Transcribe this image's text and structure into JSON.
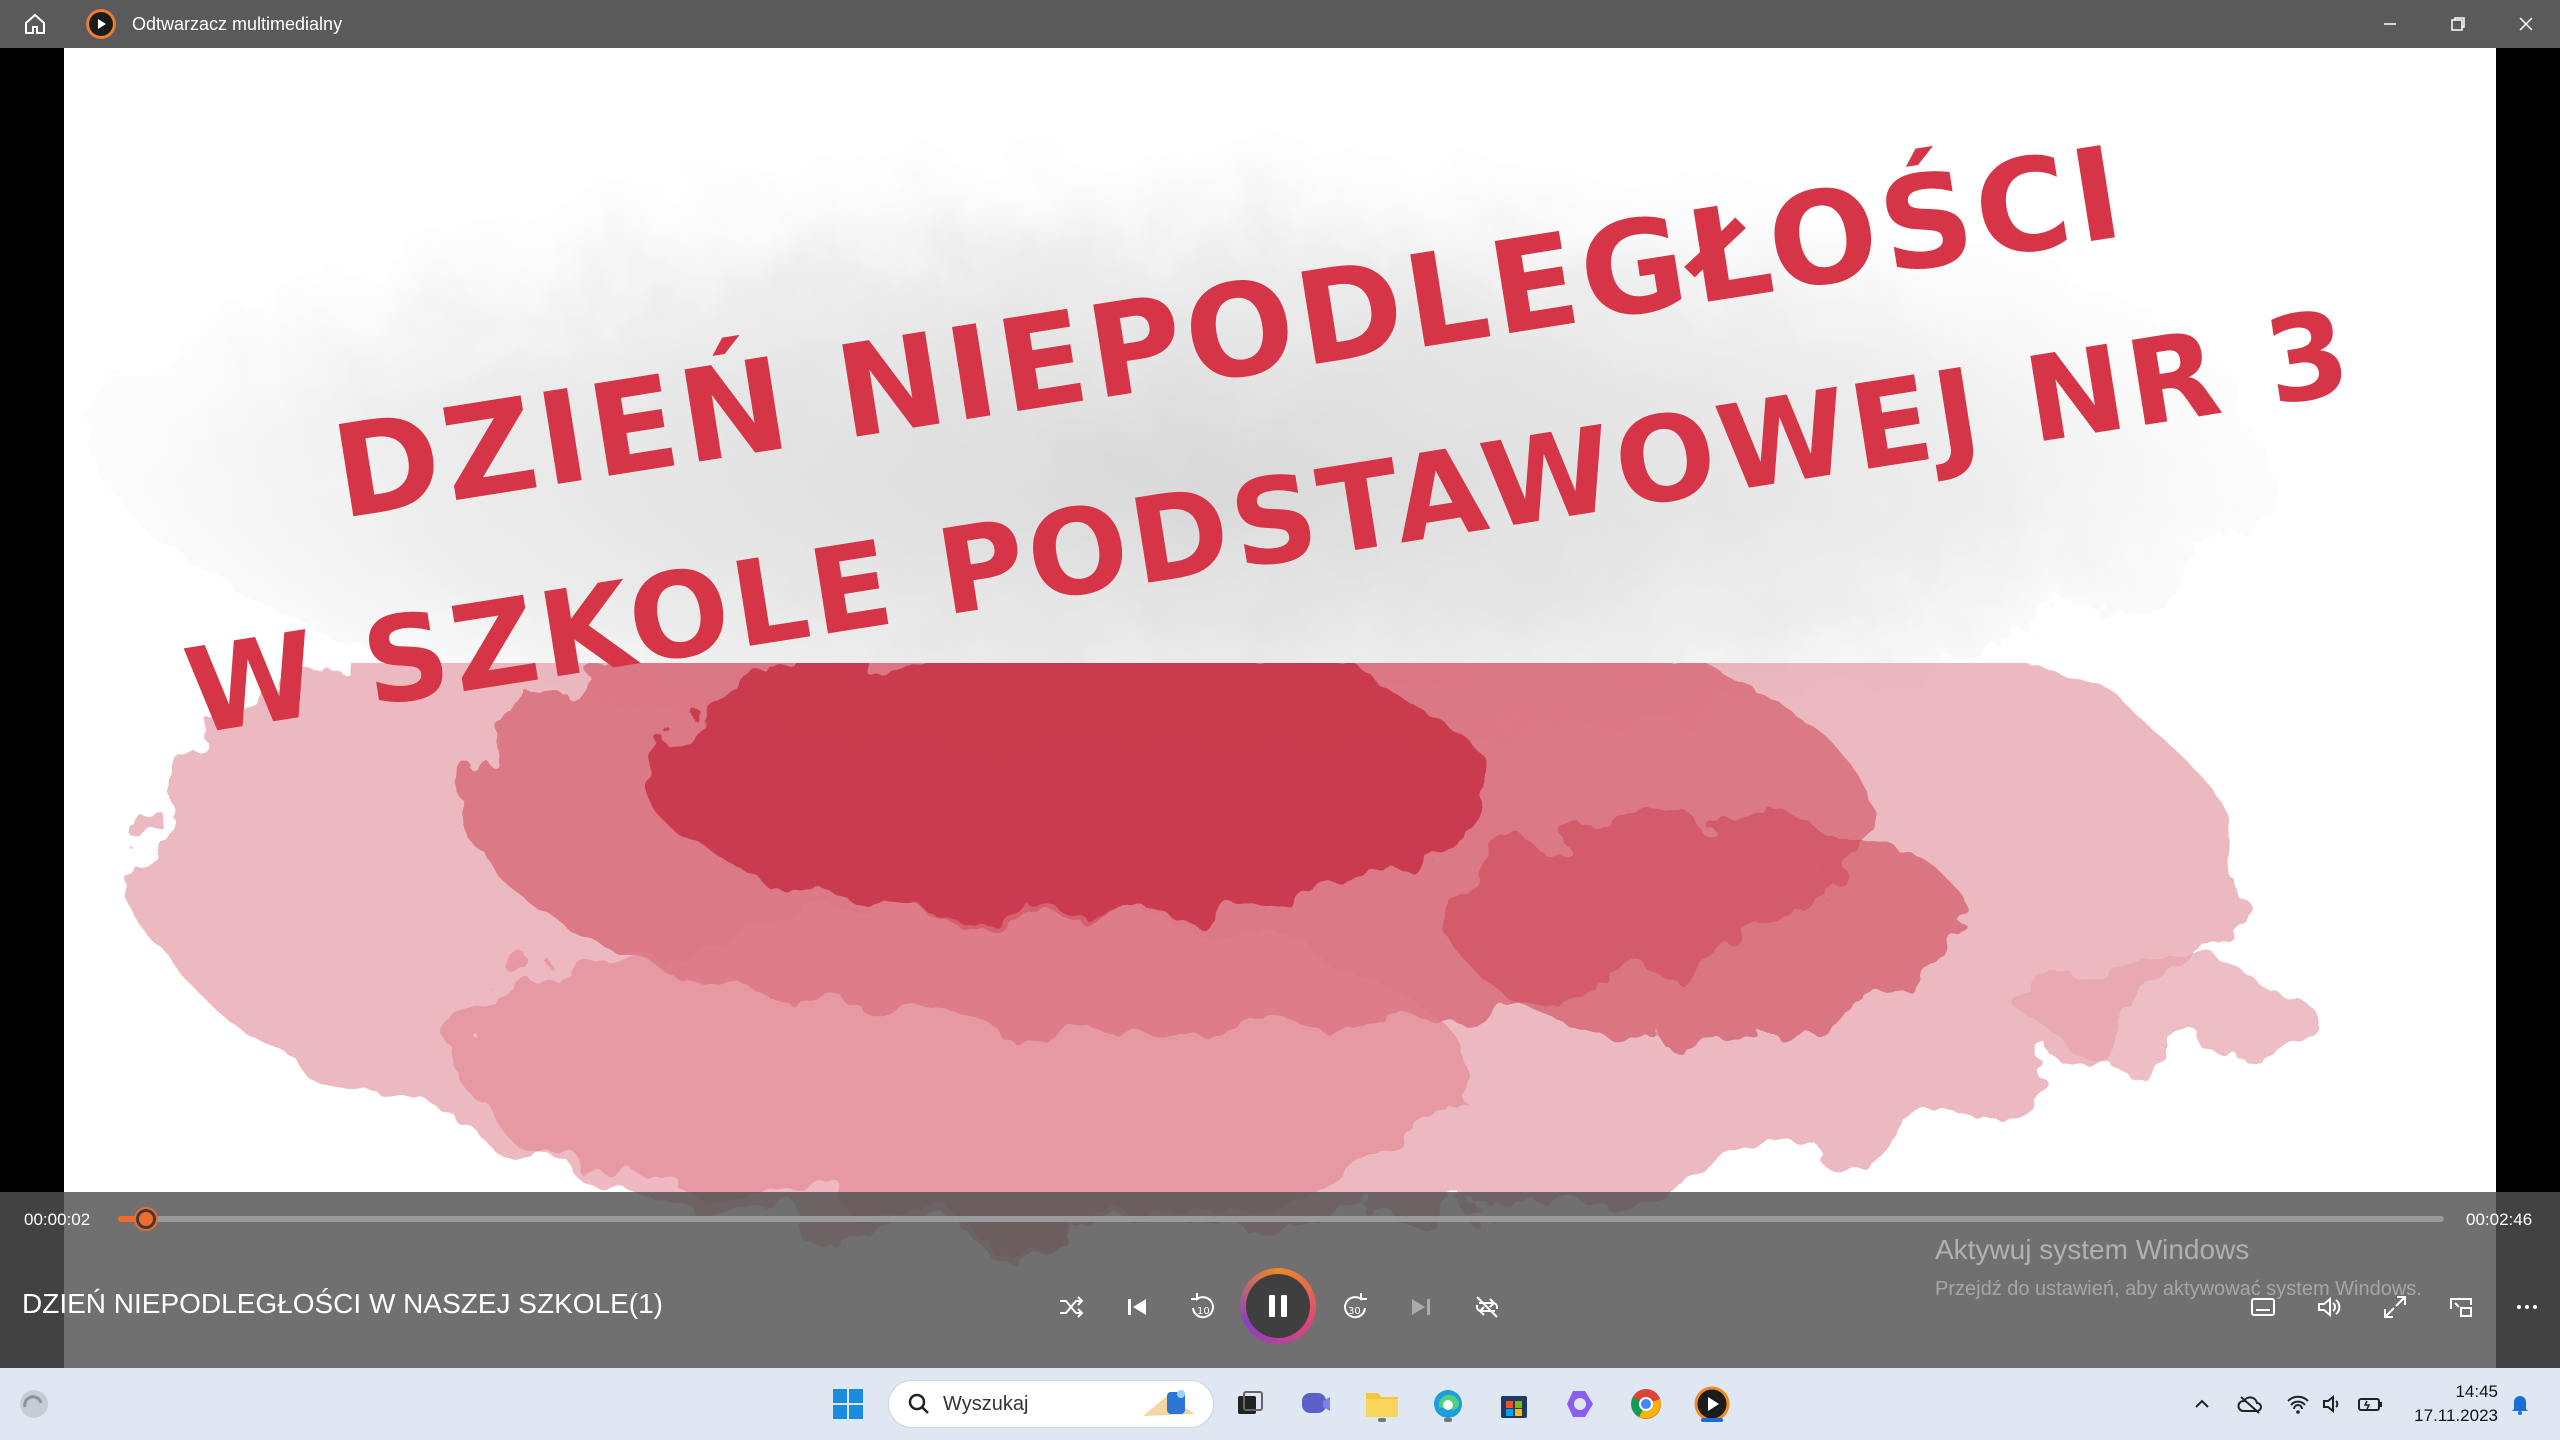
{
  "window": {
    "title": "Odtwarzacz multimedialny",
    "controls": [
      "minimize",
      "restore",
      "close"
    ]
  },
  "video": {
    "title_line1": "DZIEŃ NIEPODLEGŁOŚCI",
    "title_line2": "W SZKOLE PODSTAWOWEJ NR 3",
    "text_color": "#d63447",
    "flag_red": "#c82a3c"
  },
  "player": {
    "current_time": "00:00:02",
    "total_time": "00:02:46",
    "progress": 0.012,
    "media_title": "DZIEŃ NIEPODLEGŁOŚCI W NASZEJ SZKOLE(1)",
    "accent": "#f26b2a",
    "state": "playing",
    "buttons": [
      "shuffle-icon",
      "previous-icon",
      "rewind-10-icon",
      "pause-icon",
      "forward-30-icon",
      "next-icon",
      "repeat-icon",
      "captions-icon",
      "volume-icon",
      "fullscreen-icon",
      "miniplayer-icon",
      "more-icon"
    ],
    "rewind_label": "10",
    "forward_label": "30"
  },
  "watermark": {
    "title": "Aktywuj system Windows",
    "subtitle": "Przejdź do ustawień, aby aktywować system Windows."
  },
  "taskbar": {
    "search_placeholder": "Wyszukaj",
    "time": "14:45",
    "date": "17.11.2023"
  }
}
